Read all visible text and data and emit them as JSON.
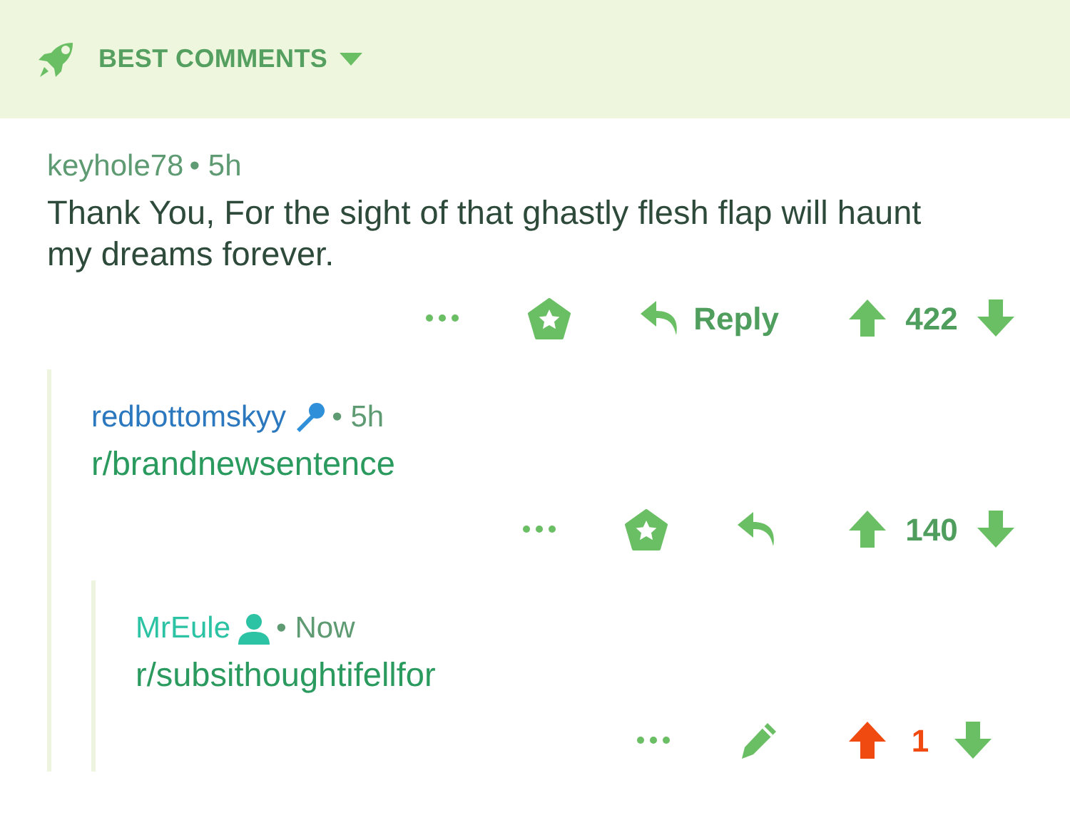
{
  "sort_bar": {
    "label": "BEST COMMENTS"
  },
  "comments": [
    {
      "author": "keyhole78",
      "color": "#5e9a72",
      "time": "• 5h",
      "body": {
        "kind": "text",
        "text": "Thank You, For the sight of that ghastly flesh flap will haunt my dreams forever."
      },
      "actions": [
        {
          "kind": "more"
        },
        {
          "kind": "award"
        },
        {
          "kind": "reply",
          "label": "Reply"
        },
        {
          "kind": "vote",
          "score": "422",
          "upvoted": false
        }
      ],
      "children": [
        {
          "author": "redbottomskyy",
          "color": "#2b78bf",
          "flair": {
            "kind": "mic"
          },
          "time": "• 5h",
          "body": {
            "kind": "link",
            "text": "r/brandnewsentence"
          },
          "actions": [
            {
              "kind": "more"
            },
            {
              "kind": "award"
            },
            {
              "kind": "reply"
            },
            {
              "kind": "vote",
              "score": "140",
              "upvoted": false
            }
          ],
          "children": [
            {
              "author": "MrEule",
              "color": "#2cc3a4",
              "flair": {
                "kind": "person"
              },
              "time": "• Now",
              "body": {
                "kind": "link",
                "text": "r/subsithoughtifellfor"
              },
              "actions": [
                {
                  "kind": "more"
                },
                {
                  "kind": "edit"
                },
                {
                  "kind": "vote",
                  "score": "1",
                  "upvoted": true
                }
              ]
            }
          ]
        }
      ]
    }
  ]
}
